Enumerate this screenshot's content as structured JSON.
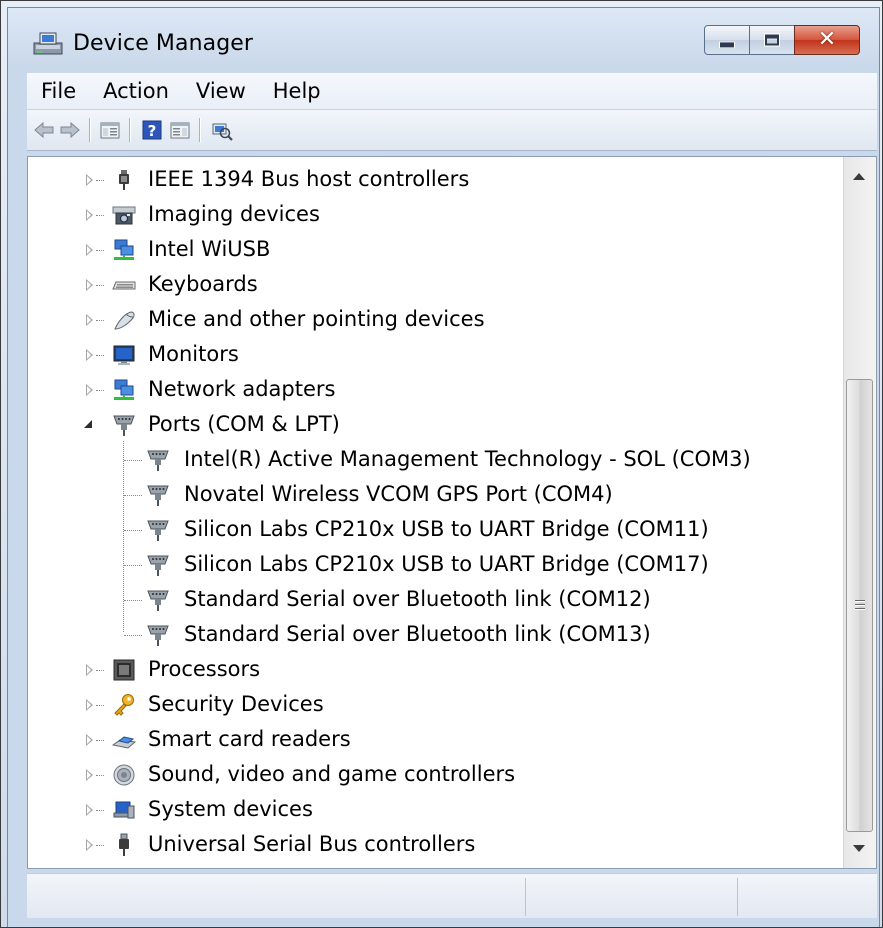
{
  "window": {
    "title": "Device Manager",
    "title_icon": "device-manager-icon",
    "controls": [
      "minimize-icon",
      "maximize-icon",
      "close-icon"
    ],
    "close_color": "#c7412a"
  },
  "menubar": {
    "items": [
      "File",
      "Action",
      "View",
      "Help"
    ]
  },
  "toolbar": {
    "icons": [
      "back-arrow-icon",
      "forward-arrow-icon",
      "show-hide-console-tree-icon",
      "help-icon",
      "show-action-pane-icon",
      "scan-hardware-icon"
    ]
  },
  "tree": {
    "nodes": [
      {
        "label": "IEEE 1394 Bus host controllers",
        "icon": "firewire-controller-icon",
        "state": "collapsed"
      },
      {
        "label": "Imaging devices",
        "icon": "camera-icon",
        "state": "collapsed"
      },
      {
        "label": "Intel WiUSB",
        "icon": "network-icon",
        "state": "collapsed"
      },
      {
        "label": "Keyboards",
        "icon": "keyboard-icon",
        "state": "collapsed"
      },
      {
        "label": "Mice and other pointing devices",
        "icon": "mouse-icon",
        "state": "collapsed"
      },
      {
        "label": "Monitors",
        "icon": "monitor-icon",
        "state": "collapsed"
      },
      {
        "label": "Network adapters",
        "icon": "network-icon",
        "state": "collapsed"
      },
      {
        "label": "Ports (COM & LPT)",
        "icon": "port-icon",
        "state": "expanded",
        "children": [
          {
            "label": "Intel(R) Active Management Technology - SOL (COM3)",
            "icon": "port-icon"
          },
          {
            "label": "Novatel Wireless VCOM GPS Port (COM4)",
            "icon": "port-icon"
          },
          {
            "label": "Silicon Labs CP210x USB to UART Bridge (COM11)",
            "icon": "port-icon"
          },
          {
            "label": "Silicon Labs CP210x USB to UART Bridge (COM17)",
            "icon": "port-icon"
          },
          {
            "label": "Standard Serial over Bluetooth link (COM12)",
            "icon": "port-icon"
          },
          {
            "label": "Standard Serial over Bluetooth link (COM13)",
            "icon": "port-icon"
          }
        ]
      },
      {
        "label": "Processors",
        "icon": "processor-icon",
        "state": "collapsed"
      },
      {
        "label": "Security Devices",
        "icon": "key-icon",
        "state": "collapsed"
      },
      {
        "label": "Smart card readers",
        "icon": "smart-card-reader-icon",
        "state": "collapsed"
      },
      {
        "label": "Sound, video and game controllers",
        "icon": "speaker-icon",
        "state": "collapsed"
      },
      {
        "label": "System devices",
        "icon": "system-devices-icon",
        "state": "collapsed"
      },
      {
        "label": "Universal Serial Bus controllers",
        "icon": "usb-icon",
        "state": "collapsed"
      }
    ]
  },
  "scrollbar": {
    "position": 0.74
  },
  "statusbar": {
    "panes": [
      "",
      "",
      ""
    ]
  }
}
